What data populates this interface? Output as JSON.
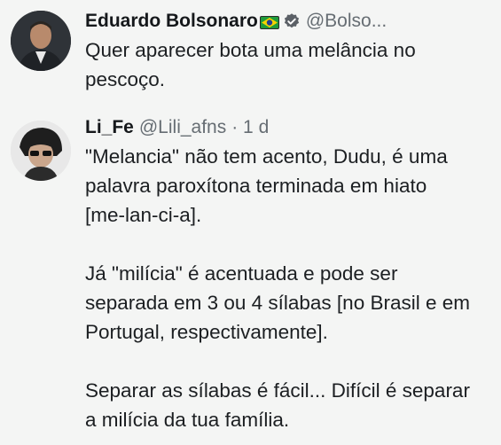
{
  "tweets": [
    {
      "display_name": "Eduardo Bolsonaro",
      "handle": "@Bolso...",
      "flag_icon": "brazil-flag-icon",
      "verified_icon": "verified-badge-icon",
      "text_lines": [
        "Quer aparecer bota uma melância no",
        "pescoço."
      ]
    },
    {
      "display_name": "Li_Fe",
      "handle": "@Lili_afns",
      "time": "· 1 d",
      "paragraphs": [
        [
          "\"Melancia\" não tem acento, Dudu, é uma",
          "palavra paroxítona terminada em hiato",
          "[me-lan-ci-a]."
        ],
        [
          "Já \"milícia\" é acentuada e pode ser",
          "separada em 3 ou 4 sílabas [no Brasil e em",
          "Portugal, respectivamente]."
        ],
        [
          "Separar as sílabas é fácil... Difícil é separar",
          "a milícia da tua família."
        ]
      ]
    }
  ],
  "colors": {
    "background": "#f4f5f4",
    "text": "#1c1f22",
    "handle": "#666d73",
    "verified": "#1d9bf0"
  }
}
